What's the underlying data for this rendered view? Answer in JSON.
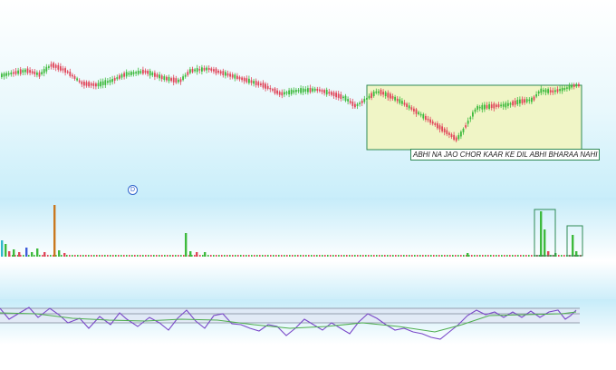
{
  "colors": {
    "up": "#3dba3d",
    "down": "#e0465a",
    "rsi_line": "#7a48c8",
    "rsi_ma": "#4fae4f",
    "annotation_fill": "#f0f5c6",
    "annotation_border": "#2f8a55",
    "panel_band": "#d6f2fb"
  },
  "annotation": {
    "text": "ABHI NA JAO CHOR KAAR KE DIL ABHI BHARAA NAHI"
  },
  "event_marker": {
    "label": "D"
  },
  "chart_data": [
    {
      "type": "candlestick",
      "panel": "price",
      "y_axis_visible": false,
      "grid": false,
      "close_path": [
        [
          0,
          84
        ],
        [
          14,
          81
        ],
        [
          30,
          78
        ],
        [
          45,
          83
        ],
        [
          58,
          72
        ],
        [
          72,
          78
        ],
        [
          90,
          92
        ],
        [
          108,
          94
        ],
        [
          125,
          89
        ],
        [
          140,
          82
        ],
        [
          160,
          79
        ],
        [
          180,
          86
        ],
        [
          200,
          90
        ],
        [
          212,
          78
        ],
        [
          230,
          76
        ],
        [
          250,
          82
        ],
        [
          270,
          88
        ],
        [
          290,
          94
        ],
        [
          310,
          104
        ],
        [
          330,
          100
        ],
        [
          350,
          99
        ],
        [
          365,
          103
        ],
        [
          380,
          108
        ],
        [
          393,
          118
        ],
        [
          405,
          110
        ],
        [
          418,
          101
        ],
        [
          430,
          106
        ],
        [
          445,
          114
        ],
        [
          460,
          124
        ],
        [
          475,
          134
        ],
        [
          490,
          144
        ],
        [
          505,
          155
        ],
        [
          512,
          146
        ],
        [
          520,
          132
        ],
        [
          528,
          119
        ],
        [
          545,
          117
        ],
        [
          560,
          116
        ],
        [
          575,
          112
        ],
        [
          590,
          110
        ],
        [
          598,
          100
        ],
        [
          612,
          101
        ],
        [
          625,
          98
        ],
        [
          637,
          94
        ]
      ],
      "highlight_box_x": [
        405,
        642
      ]
    },
    {
      "type": "bar",
      "panel": "volume",
      "y_axis_visible": false,
      "bars": [
        [
          1,
          18,
          "up"
        ],
        [
          5,
          14,
          "up"
        ],
        [
          9,
          6,
          "down"
        ],
        [
          14,
          8,
          "up"
        ],
        [
          20,
          5,
          "down"
        ],
        [
          28,
          10,
          "down"
        ],
        [
          34,
          5,
          "up"
        ],
        [
          40,
          9,
          "up"
        ],
        [
          48,
          5,
          "down"
        ],
        [
          59,
          57,
          "down"
        ],
        [
          64,
          7,
          "up"
        ],
        [
          70,
          4,
          "down"
        ],
        [
          204,
          26,
          "up"
        ],
        [
          209,
          6,
          "up"
        ],
        [
          216,
          5,
          "down"
        ],
        [
          225,
          5,
          "up"
        ],
        [
          515,
          4,
          "up"
        ],
        [
          596,
          50,
          "up"
        ],
        [
          600,
          30,
          "up"
        ],
        [
          604,
          6,
          "down"
        ],
        [
          612,
          4,
          "up"
        ],
        [
          631,
          24,
          "up"
        ],
        [
          635,
          6,
          "up"
        ]
      ],
      "baseline_bars": {
        "from_x": 10,
        "to_x": 640,
        "step": 3,
        "value": 2
      },
      "highlight_box_x": [
        [
          590,
          613
        ],
        [
          626,
          643
        ]
      ]
    },
    {
      "type": "line",
      "panel": "rsi",
      "y_axis_visible": false,
      "series": [
        {
          "key": "rsi",
          "color_key": "rsi_line",
          "points": [
            [
              0,
              340
            ],
            [
              10,
              352
            ],
            [
              20,
              346
            ],
            [
              32,
              339
            ],
            [
              42,
              350
            ],
            [
              55,
              340
            ],
            [
              65,
              347
            ],
            [
              75,
              356
            ],
            [
              88,
              351
            ],
            [
              98,
              362
            ],
            [
              110,
              349
            ],
            [
              122,
              358
            ],
            [
              132,
              345
            ],
            [
              140,
              352
            ],
            [
              152,
              360
            ],
            [
              165,
              350
            ],
            [
              176,
              356
            ],
            [
              186,
              364
            ],
            [
              196,
              351
            ],
            [
              206,
              342
            ],
            [
              216,
              354
            ],
            [
              226,
              362
            ],
            [
              236,
              348
            ],
            [
              246,
              346
            ],
            [
              256,
              357
            ],
            [
              266,
              358
            ],
            [
              276,
              362
            ],
            [
              286,
              365
            ],
            [
              296,
              358
            ],
            [
              306,
              360
            ],
            [
              316,
              370
            ],
            [
              326,
              362
            ],
            [
              336,
              352
            ],
            [
              346,
              358
            ],
            [
              356,
              364
            ],
            [
              366,
              356
            ],
            [
              376,
              362
            ],
            [
              386,
              368
            ],
            [
              396,
              355
            ],
            [
              406,
              346
            ],
            [
              416,
              351
            ],
            [
              426,
              358
            ],
            [
              436,
              364
            ],
            [
              446,
              362
            ],
            [
              456,
              366
            ],
            [
              466,
              368
            ],
            [
              476,
              372
            ],
            [
              486,
              374
            ],
            [
              496,
              366
            ],
            [
              506,
              358
            ],
            [
              516,
              348
            ],
            [
              526,
              342
            ],
            [
              536,
              347
            ],
            [
              546,
              344
            ],
            [
              556,
              350
            ],
            [
              566,
              344
            ],
            [
              576,
              350
            ],
            [
              586,
              343
            ],
            [
              596,
              350
            ],
            [
              606,
              344
            ],
            [
              616,
              342
            ],
            [
              624,
              352
            ],
            [
              630,
              348
            ],
            [
              636,
              342
            ]
          ]
        },
        {
          "key": "rsi_ma",
          "color_key": "rsi_ma",
          "points": [
            [
              0,
              345
            ],
            [
              40,
              346
            ],
            [
              80,
              351
            ],
            [
              120,
              353
            ],
            [
              160,
              354
            ],
            [
              200,
              352
            ],
            [
              240,
              353
            ],
            [
              280,
              358
            ],
            [
              320,
              362
            ],
            [
              360,
              360
            ],
            [
              400,
              356
            ],
            [
              440,
              360
            ],
            [
              480,
              366
            ],
            [
              510,
              358
            ],
            [
              540,
              348
            ],
            [
              580,
              347
            ],
            [
              620,
              346
            ],
            [
              636,
              344
            ]
          ]
        }
      ],
      "levels": [
        340,
        346,
        356
      ]
    }
  ]
}
